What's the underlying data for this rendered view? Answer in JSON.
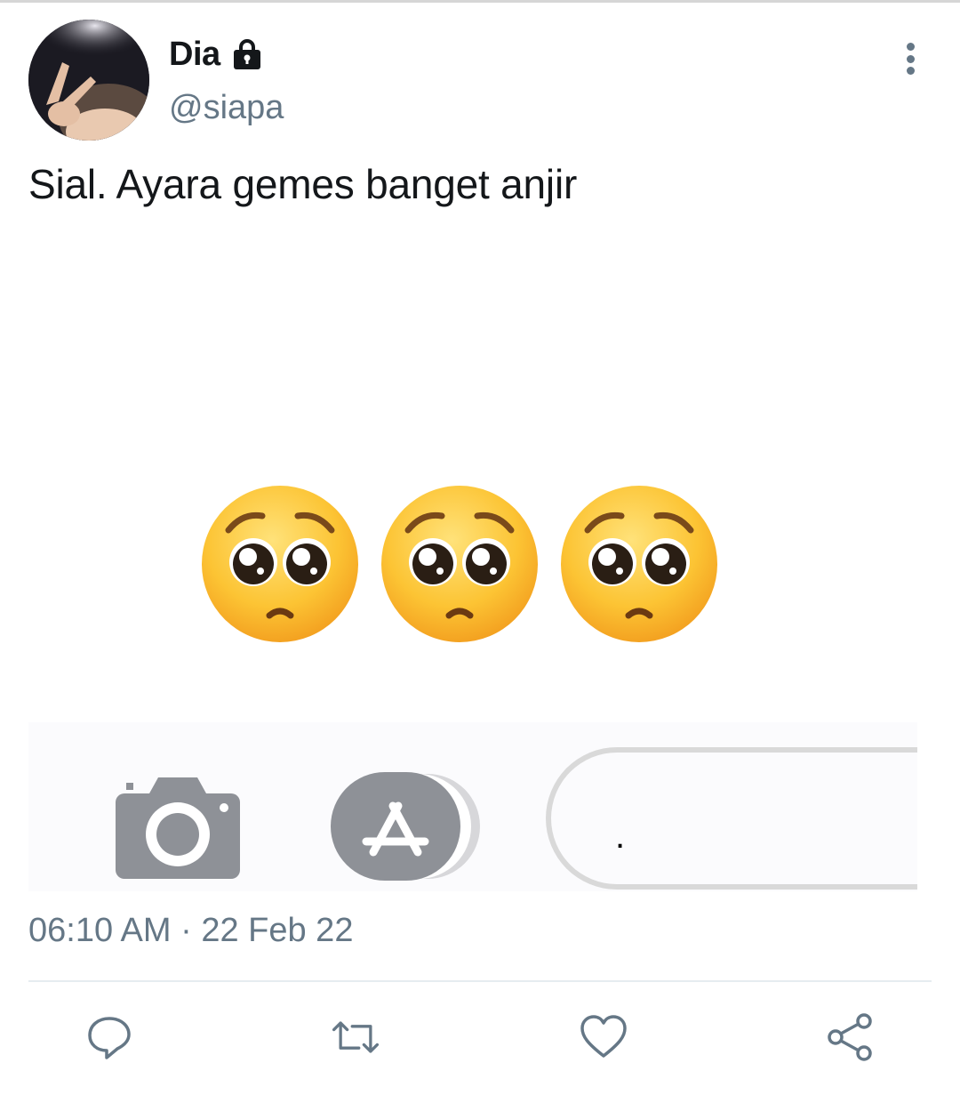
{
  "tweet": {
    "display_name": "Dia",
    "handle": "@siapa",
    "text": "Sial. Ayara gemes banget anjir",
    "timestamp": "06:10 AM · 22 Feb 22",
    "media_text": "."
  },
  "icons": {
    "lock": "lock-icon",
    "more": "more-vertical-icon",
    "reply": "reply-icon",
    "retweet": "retweet-icon",
    "like": "heart-icon",
    "share": "share-icon",
    "camera": "camera-icon",
    "appstore": "app-store-icon"
  },
  "colors": {
    "text": "#14171a",
    "secondary": "#657786",
    "divider": "#e6ecf0",
    "emoji_face": "#fbc02d",
    "media_icon_gray": "#8e9197"
  }
}
